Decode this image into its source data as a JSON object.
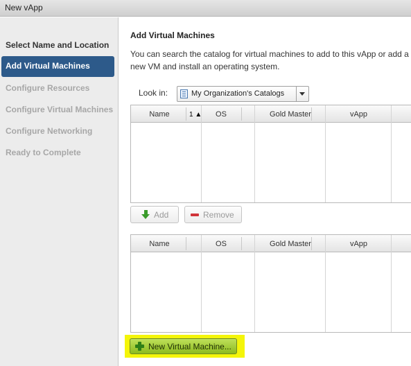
{
  "window": {
    "title": "New vApp"
  },
  "sidebar": {
    "heading": "Select Name and Location",
    "items": [
      {
        "label": "Add Virtual Machines",
        "state": "active"
      },
      {
        "label": "Configure Resources",
        "state": "disabled"
      },
      {
        "label": "Configure Virtual Machines",
        "state": "disabled"
      },
      {
        "label": "Configure Networking",
        "state": "disabled"
      },
      {
        "label": "Ready to Complete",
        "state": "disabled"
      }
    ]
  },
  "main": {
    "title": "Add Virtual Machines",
    "description_line1": "You can search the catalog for virtual machines to add to this vApp or add a",
    "description_line2": "new VM and install an operating system.",
    "look_in": {
      "label": "Look in:",
      "selected": "My Organization's Catalogs",
      "icon": "catalog-icon"
    },
    "catalog_table": {
      "columns": [
        "Name",
        "OS",
        "Gold Master",
        "vApp"
      ],
      "sort_indicator": "1 ▲",
      "rows": []
    },
    "add_button": {
      "label": "Add",
      "icon": "green-down-arrow-icon",
      "enabled": false
    },
    "remove_button": {
      "label": "Remove",
      "icon": "red-minus-icon",
      "enabled": false
    },
    "selected_table": {
      "columns": [
        "Name",
        "OS",
        "Gold Master",
        "vApp"
      ],
      "rows": []
    },
    "new_vm_button": {
      "label": "New Virtual Machine...",
      "icon": "green-plus-icon",
      "highlight_color": "#f4f50a"
    }
  },
  "colors": {
    "active_step": "#2d5a8a",
    "new_vm_button": "#9cc72e"
  }
}
